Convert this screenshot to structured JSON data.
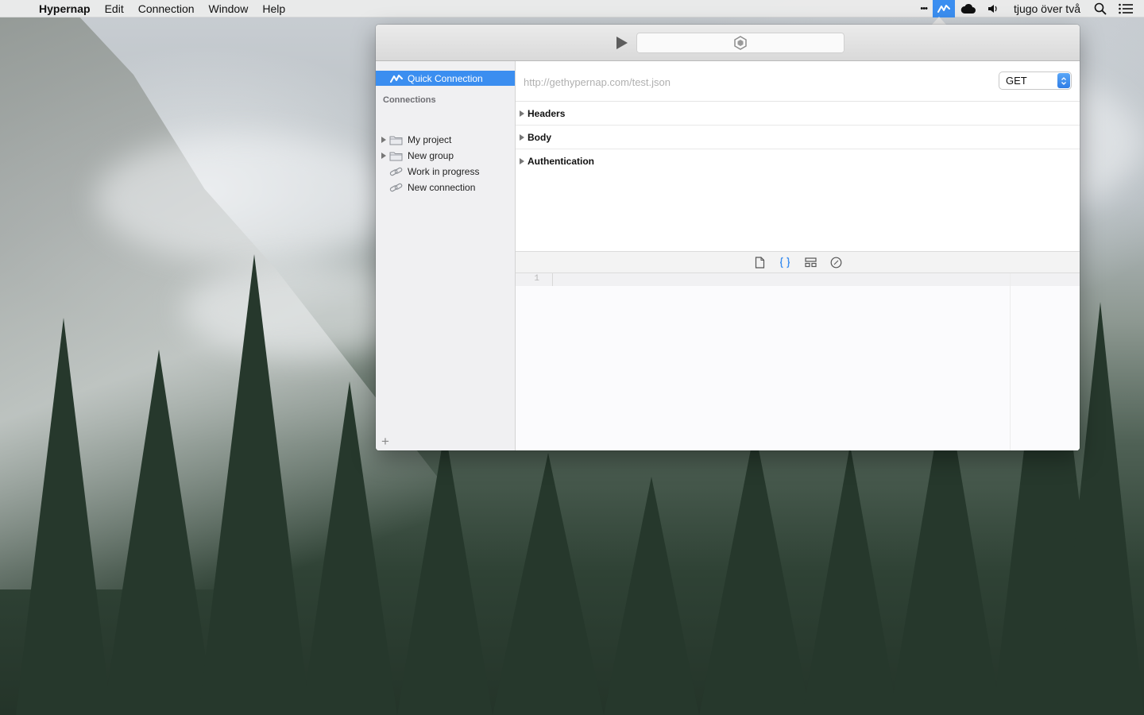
{
  "menubar": {
    "apple_symbol": "",
    "app_name": "Hypernap",
    "menus": [
      "Edit",
      "Connection",
      "Window",
      "Help"
    ],
    "status_items": {
      "more_symbol": "•••",
      "clock": "tjugo över två"
    }
  },
  "toolbar": {
    "run_icon": "play-icon",
    "activity_icon": "hexagon-logo-icon"
  },
  "sidebar": {
    "quick_connection": "Quick Connection",
    "section_title": "Connections",
    "items": [
      {
        "label": "My project",
        "type": "folder",
        "expandable": true
      },
      {
        "label": "New group",
        "type": "folder",
        "expandable": true
      },
      {
        "label": "Work in progress",
        "type": "connection",
        "expandable": false
      },
      {
        "label": "New connection",
        "type": "connection",
        "expandable": false
      }
    ],
    "add_symbol": "+"
  },
  "request": {
    "url_value": "",
    "url_placeholder": "http://gethypernap.com/test.json",
    "method": "GET",
    "sections": [
      "Headers",
      "Body",
      "Authentication"
    ]
  },
  "response": {
    "view_buttons": [
      "document-icon",
      "braces-icon",
      "layout-icon",
      "compass-icon"
    ],
    "active_view": "braces-icon",
    "line_numbers": [
      "1"
    ]
  },
  "colors": {
    "accent": "#3b8ef0"
  }
}
